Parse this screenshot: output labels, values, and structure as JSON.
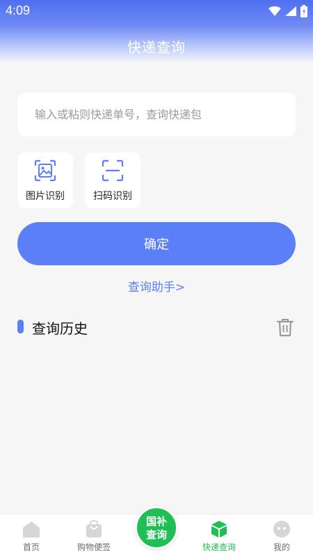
{
  "status_bar": {
    "time": "4:09"
  },
  "header": {
    "title": "快递查询"
  },
  "search": {
    "placeholder": "输入或粘则快递单号，查询快递包",
    "value": ""
  },
  "tools": [
    {
      "label": "图片识别",
      "icon": "image-scan-icon"
    },
    {
      "label": "扫码识别",
      "icon": "qr-scan-icon"
    }
  ],
  "confirm_label": "确定",
  "helper_link": "查询助手>",
  "history": {
    "title": "查询历史"
  },
  "tabbar": {
    "tabs": [
      {
        "label": "首页",
        "icon": "home-icon"
      },
      {
        "label": "购物便签",
        "icon": "shopping-bag-icon"
      },
      {
        "label": "快递查询",
        "icon": "package-icon",
        "active": true
      },
      {
        "label": "我的",
        "icon": "profile-face-icon"
      }
    ],
    "center_button": {
      "line1": "国补",
      "line2": "查询"
    }
  },
  "colors": {
    "accent": "#5b7ff7",
    "active_tab": "#1fbf55",
    "background": "#f6f6f7"
  }
}
